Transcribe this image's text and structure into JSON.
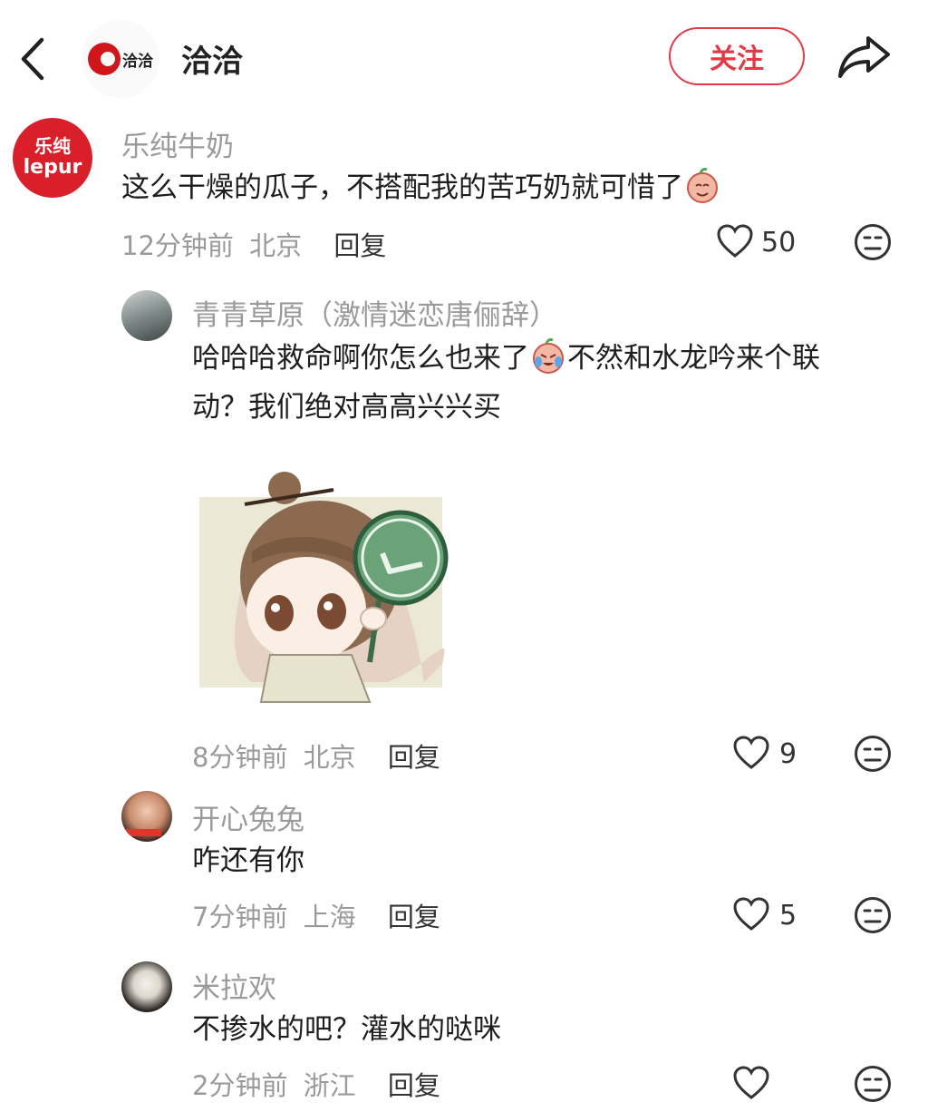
{
  "header": {
    "brand_logo_text": "洽洽",
    "brand_name": "洽洽",
    "follow_label": "关注"
  },
  "comments": [
    {
      "avatar_text_top": "乐纯",
      "avatar_text_bottom": "lepur",
      "username": "乐纯牛奶",
      "text": "这么干燥的瓜子，不搭配我的苦巧奶就可惜了",
      "time": "12分钟前",
      "location": "北京",
      "reply_label": "回复",
      "likes": "50"
    },
    {
      "username": "青青草原（激情迷恋唐俪辞）",
      "text_line1": "哈哈哈救命啊你怎么也来了",
      "text_line1b": "不然和水龙吟来个联",
      "text_line2": "动？我们绝对高高兴兴买",
      "time": "8分钟前",
      "location": "北京",
      "reply_label": "回复",
      "likes": "9"
    },
    {
      "username": "开心兔兔",
      "text": "咋还有你",
      "time": "7分钟前",
      "location": "上海",
      "reply_label": "回复",
      "likes": "5"
    },
    {
      "username": "米拉欢",
      "text": "不掺水的吧？灌水的哒咪",
      "time": "2分钟前",
      "location": "浙江",
      "reply_label": "回复"
    }
  ],
  "colors": {
    "accent": "#e23a47",
    "brand_red": "#d0161b",
    "lepur_red": "#d9202a",
    "meta_gray": "#9a9a9a"
  },
  "icons": [
    "back-arrow-icon",
    "share-icon",
    "heart-icon",
    "face-icon",
    "sticker-image"
  ]
}
